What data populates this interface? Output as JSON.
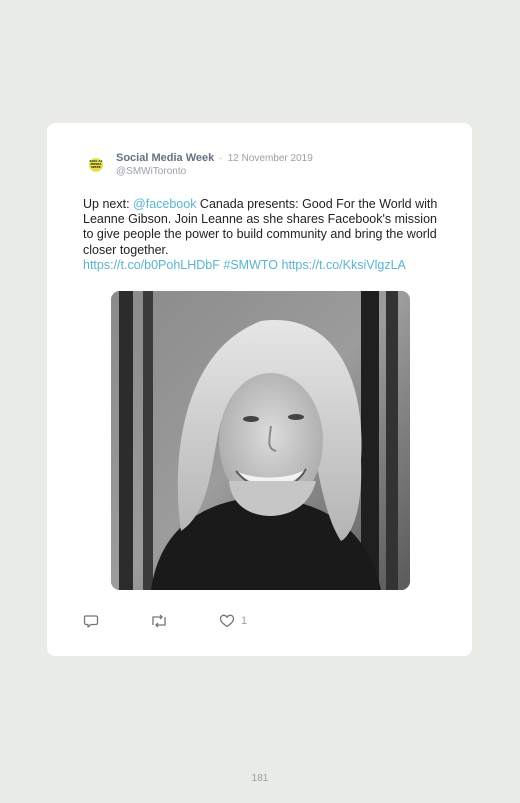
{
  "tweet": {
    "author": {
      "avatar_text": "SOCIAL MEDIA WEEK",
      "name": "Social Media Week",
      "separator": "·",
      "date": "12 November 2019",
      "handle": "@SMWiToronto"
    },
    "text": {
      "part1": "Up next: ",
      "mention": "@facebook",
      "part2": " Canada presents: Good For the World with Leanne Gibson. Join Leanne as she shares Facebook's mission to give people the power to build community and bring the world closer together.",
      "link1": "https://t.co/b0PohLHDbF",
      "hashtag": "#SMWTO",
      "link2": "https://t.co/KksiVlgzLA"
    },
    "actions": {
      "reply_icon": "reply-icon",
      "retweet_icon": "retweet-icon",
      "like_icon": "heart-icon",
      "like_count": "1"
    }
  },
  "page": {
    "number": "181"
  },
  "colors": {
    "background": "#e9ebe6",
    "card": "#ffffff",
    "link": "#5ab4cf",
    "author": "#667080"
  }
}
